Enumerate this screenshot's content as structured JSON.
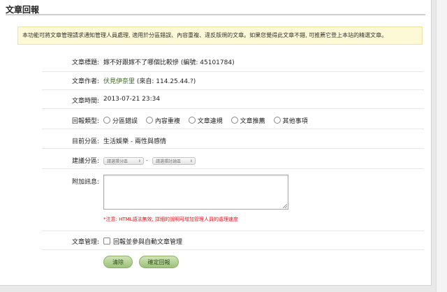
{
  "page": {
    "title": "文章回報",
    "notice": "本功能可將文章管理請求通知管理人員處理, 適用於分區錯誤、內容重複、違反版規的文章。如果您覺得此文章不錯, 可推薦它登上本站的精選文章。"
  },
  "fields": {
    "article_title_label": "文章標題:",
    "article_title_value": "嫁不好跟嫁不了哪個比較慘 (編號: 45101784)",
    "author_label": "文章作者:",
    "author_name": "伏見伊奈里",
    "author_source": "(來自: 114.25.44.?)",
    "time_label": "文章時間:",
    "time_value": "2013-07-21 23:34",
    "report_type_label": "回報類型:",
    "report_types": [
      "分區錯誤",
      "內容重複",
      "文章違規",
      "文章推薦",
      "其他事項"
    ],
    "current_section_label": "目前分區:",
    "current_section_value": "生活娛樂 - 兩性與感情",
    "suggest_section_label": "建議分區:",
    "suggest_section_placeholder": "請選擇分區",
    "suggest_board_placeholder": "請選擇討論區",
    "dash": "-",
    "extra_info_label": "附加訊息:",
    "extra_info_value": "",
    "note": "*注意: HTML語法無效, 詳細的說明可增加管理人員的處理速度",
    "manage_label": "文章管理:",
    "manage_checkbox": "回報並參與自動文章管理"
  },
  "buttons": {
    "clear": "清除",
    "submit": "確定回報"
  },
  "colors": {
    "notice_bg": "#fdf9d6",
    "author_green": "#3a6a24",
    "note_red": "#e0151b",
    "button_green": "#9cc178"
  }
}
